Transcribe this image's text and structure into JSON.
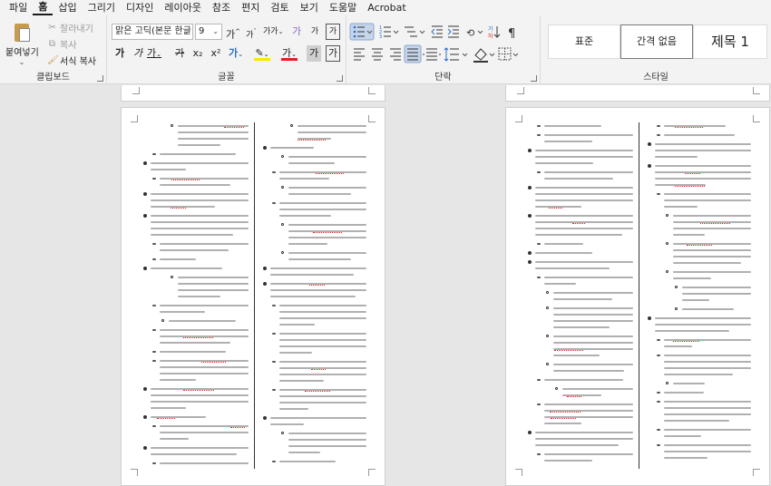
{
  "menu": [
    "파일",
    "홈",
    "삽입",
    "그리기",
    "디자인",
    "레이아웃",
    "참조",
    "편지",
    "검토",
    "보기",
    "도움말",
    "Acrobat"
  ],
  "menu_active_index": 1,
  "clipboard": {
    "paste": "붙여넣기",
    "cut": "잘라내기",
    "copy": "복사",
    "format_painter": "서식 복사",
    "label": "클립보드"
  },
  "font": {
    "name": "맑은 고딕(본문 한글",
    "size": "9",
    "grow": "가",
    "shrink": "가",
    "case": "가가",
    "clear": "가",
    "phonetic": "가",
    "enclose": "가",
    "bold": "가",
    "italic": "가",
    "underline": "가",
    "strike": "가",
    "subscript": "x₂",
    "superscript": "x²",
    "effects": "가",
    "highlight_color": "#ffe600",
    "font_color_glyph": "가",
    "font_color": "#e02020",
    "shade": "가",
    "border": "가",
    "label": "글꼴"
  },
  "paragraph": {
    "label": "단락"
  },
  "styles": {
    "items": [
      "표준",
      "간격 없음",
      "제목 1"
    ],
    "selected_index": 1,
    "label": "스타일"
  }
}
